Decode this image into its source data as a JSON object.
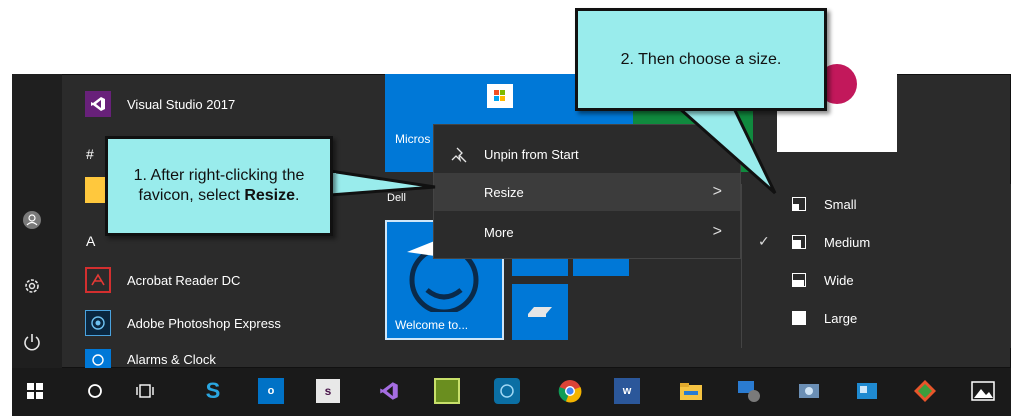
{
  "start_menu": {
    "left_rail": {
      "user_icon": "user-avatar-icon",
      "settings_icon": "gear-icon",
      "power_icon": "power-icon"
    },
    "section_letters": [
      "#",
      "A"
    ],
    "apps": [
      {
        "label": "Visual Studio 2017",
        "icon": "visual-studio-icon"
      },
      {
        "label": "Acrobat Reader DC",
        "icon": "acrobat-icon"
      },
      {
        "label": "Adobe Photoshop Express",
        "icon": "photoshop-express-icon"
      },
      {
        "label": "Alarms & Clock",
        "icon": "alarms-clock-icon"
      }
    ],
    "tiles": {
      "store_label": "Micros",
      "dell_label": "Dell",
      "welcome_label": "Welcome to..."
    }
  },
  "context_menu": {
    "items": [
      {
        "label": "Unpin from Start",
        "icon": "unpin-icon"
      },
      {
        "label": "Resize",
        "chevron": ">"
      },
      {
        "label": "More",
        "chevron": ">"
      }
    ]
  },
  "resize_submenu": {
    "items": [
      {
        "label": "Small",
        "checked": false
      },
      {
        "label": "Medium",
        "checked": true
      },
      {
        "label": "Wide",
        "checked": false
      },
      {
        "label": "Large",
        "checked": false
      }
    ],
    "check_glyph": "✓"
  },
  "callouts": {
    "step1_prefix": "1. After right-clicking the favicon, select ",
    "step1_bold": "Resize",
    "step1_suffix": ".",
    "step2": "2. Then choose a size."
  },
  "taskbar": {
    "icons": [
      "windows-start-icon",
      "cortana-icon",
      "task-view-icon",
      "snagit-icon",
      "outlook-icon",
      "slack-icon",
      "visual-studio-icon",
      "notepad-icon",
      "webcam-icon",
      "chrome-icon",
      "word-icon",
      "file-explorer-icon",
      "network-icon",
      "photos-icon",
      "contacts-icon",
      "git-icon",
      "image-icon"
    ]
  },
  "colors": {
    "callout_fill": "#99ecec",
    "start_bg": "#2b2b2b",
    "tile_blue": "#0078d7",
    "tile_green": "#108a3e"
  }
}
